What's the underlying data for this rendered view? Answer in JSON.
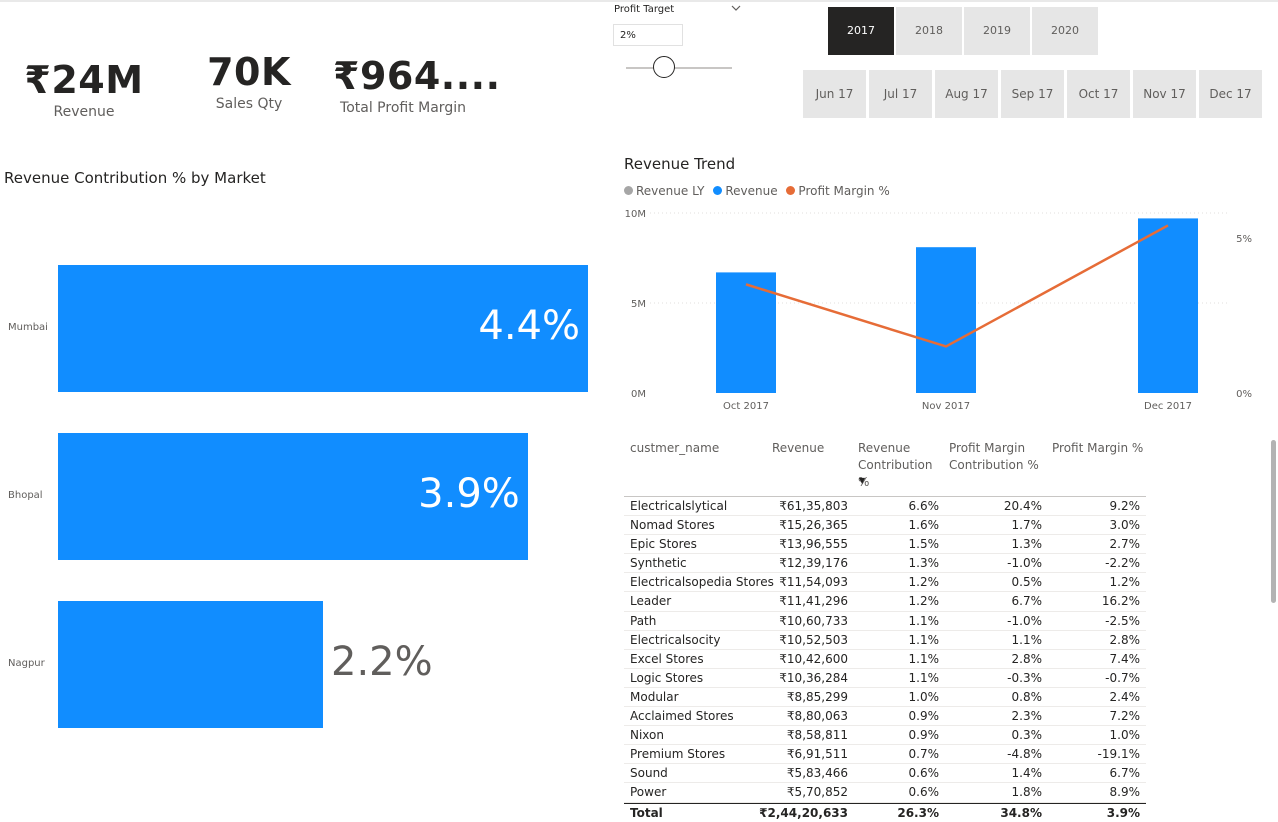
{
  "kpis": [
    {
      "value": "₹24M",
      "label": "Revenue"
    },
    {
      "value": "70K",
      "label": "Sales Qty"
    },
    {
      "value": "₹964....",
      "label": "Total Profit Margin"
    }
  ],
  "profit_target": {
    "title": "Profit Target",
    "value": "2%",
    "chevron_icon": "chevron-down-icon"
  },
  "years": [
    {
      "label": "2017",
      "selected": true
    },
    {
      "label": "2018",
      "selected": false
    },
    {
      "label": "2019",
      "selected": false
    },
    {
      "label": "2020",
      "selected": false
    }
  ],
  "months": [
    "Jun 17",
    "Jul 17",
    "Aug 17",
    "Sep 17",
    "Oct 17",
    "Nov 17",
    "Dec 17"
  ],
  "colors": {
    "accent": "#118dff",
    "line": "#e66c37",
    "revenue_ly": "#a6a6a6",
    "selected_tile": "#252423"
  },
  "market_chart": {
    "title": "Revenue Contribution % by Market",
    "chart_data": {
      "type": "bar",
      "orientation": "horizontal",
      "categories": [
        "Mumbai",
        "Bhopal",
        "Nagpur"
      ],
      "values": [
        4.4,
        3.9,
        2.2
      ],
      "labels": [
        "4.4%",
        "3.9%",
        "2.2%"
      ],
      "xlim": [
        0,
        4.4
      ]
    }
  },
  "trend_chart": {
    "title": "Revenue Trend",
    "legend": [
      "Revenue LY",
      "Revenue",
      "Profit Margin %"
    ],
    "y_ticks": [
      "10M",
      "5M",
      "0M"
    ],
    "y2_ticks": [
      "5%",
      "0%"
    ],
    "chart_data": {
      "type": "bar",
      "categories": [
        "Oct 2017",
        "Nov 2017",
        "Dec 2017"
      ],
      "series": [
        {
          "name": "Revenue",
          "type": "bar",
          "values": [
            6.7,
            8.1,
            9.7
          ],
          "unit": "M"
        },
        {
          "name": "Profit Margin %",
          "type": "line",
          "axis": "secondary",
          "values": [
            3.5,
            1.5,
            5.4
          ],
          "unit": "%"
        }
      ],
      "ylim": [
        0,
        10
      ],
      "y2lim": [
        0,
        5.8
      ]
    }
  },
  "table": {
    "headers": [
      "custmer_name",
      "Revenue",
      "Revenue Contribution %",
      "Profit Margin Contribution %",
      "Profit Margin %"
    ],
    "rows": [
      [
        "Electricalslytical",
        "₹61,35,803",
        "6.6%",
        "20.4%",
        "9.2%"
      ],
      [
        "Nomad Stores",
        "₹15,26,365",
        "1.6%",
        "1.7%",
        "3.0%"
      ],
      [
        "Epic Stores",
        "₹13,96,555",
        "1.5%",
        "1.3%",
        "2.7%"
      ],
      [
        "Synthetic",
        "₹12,39,176",
        "1.3%",
        "-1.0%",
        "-2.2%"
      ],
      [
        "Electricalsopedia Stores",
        "₹11,54,093",
        "1.2%",
        "0.5%",
        "1.2%"
      ],
      [
        "Leader",
        "₹11,41,296",
        "1.2%",
        "6.7%",
        "16.2%"
      ],
      [
        "Path",
        "₹10,60,733",
        "1.1%",
        "-1.0%",
        "-2.5%"
      ],
      [
        "Electricalsocity",
        "₹10,52,503",
        "1.1%",
        "1.1%",
        "2.8%"
      ],
      [
        "Excel Stores",
        "₹10,42,600",
        "1.1%",
        "2.8%",
        "7.4%"
      ],
      [
        "Logic Stores",
        "₹10,36,284",
        "1.1%",
        "-0.3%",
        "-0.7%"
      ],
      [
        "Modular",
        "₹8,85,299",
        "1.0%",
        "0.8%",
        "2.4%"
      ],
      [
        "Acclaimed Stores",
        "₹8,80,063",
        "0.9%",
        "2.3%",
        "7.2%"
      ],
      [
        "Nixon",
        "₹8,58,811",
        "0.9%",
        "0.3%",
        "1.0%"
      ],
      [
        "Premium Stores",
        "₹6,91,511",
        "0.7%",
        "-4.8%",
        "-19.1%"
      ],
      [
        "Sound",
        "₹5,83,466",
        "0.6%",
        "1.4%",
        "6.7%"
      ],
      [
        "Power",
        "₹5,70,852",
        "0.6%",
        "1.8%",
        "8.9%"
      ]
    ],
    "total": [
      "Total",
      "₹2,44,20,633",
      "26.3%",
      "34.8%",
      "3.9%"
    ]
  }
}
